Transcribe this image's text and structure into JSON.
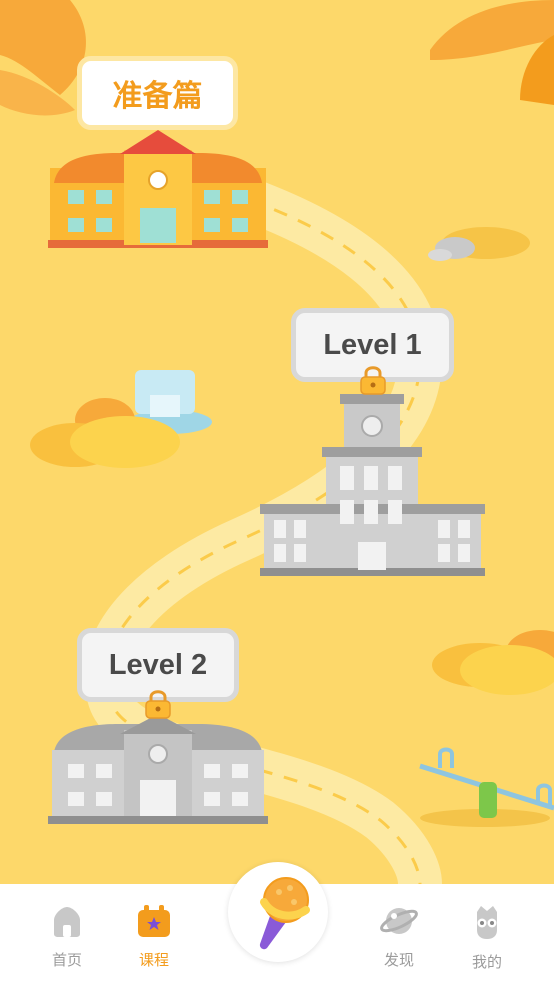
{
  "stages": [
    {
      "label": "准备篇",
      "locked": false
    },
    {
      "label": "Level 1",
      "locked": true
    },
    {
      "label": "Level 2",
      "locked": true
    }
  ],
  "tabs": [
    {
      "label": "首页",
      "icon": "home-icon",
      "active": false
    },
    {
      "label": "课程",
      "icon": "course-calendar-icon",
      "active": true
    },
    {
      "label": "发现",
      "icon": "planet-icon",
      "active": false
    },
    {
      "label": "我的",
      "icon": "owl-profile-icon",
      "active": false
    }
  ],
  "center_button": {
    "icon": "microphone-icon"
  },
  "colors": {
    "background": "#fdd86a",
    "accent": "#f39c1d",
    "road": "#fdeaa3",
    "locked_gray": "#bdbdbd"
  }
}
